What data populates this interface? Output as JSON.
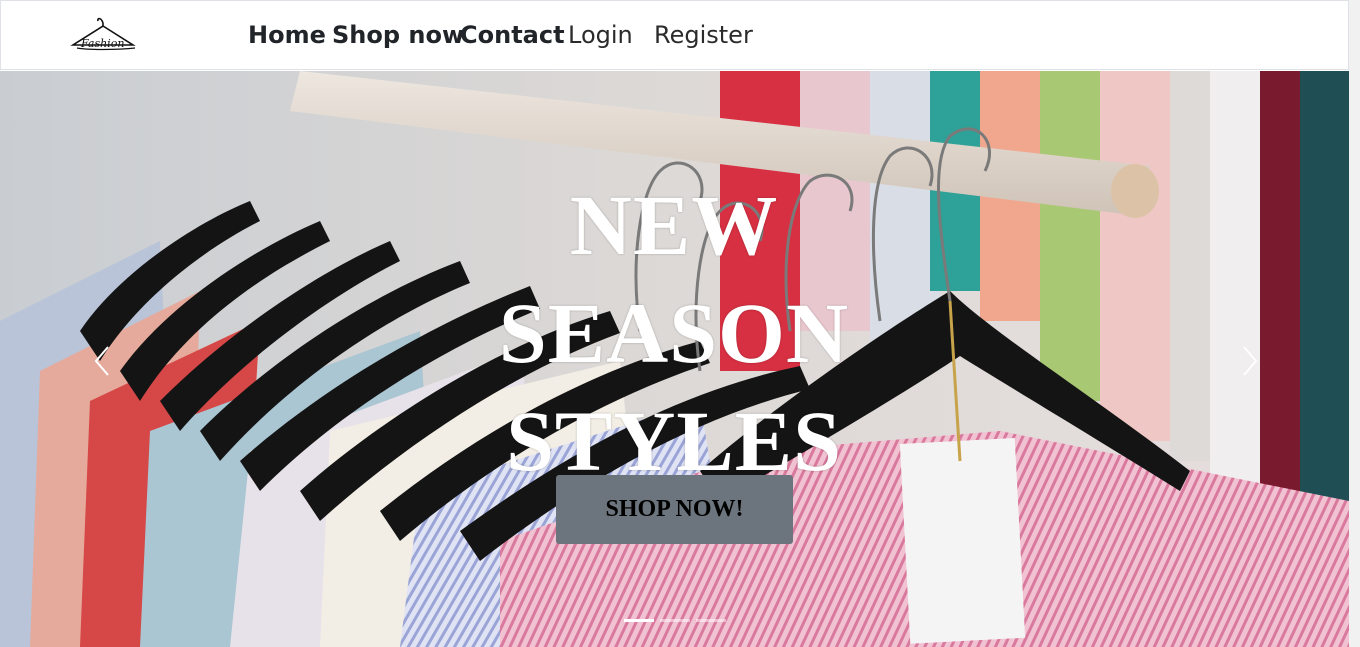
{
  "nav": {
    "logo_text": "Fashion",
    "links": [
      {
        "label": "Home",
        "weight": "bold"
      },
      {
        "label": "Shop now",
        "weight": "bold"
      },
      {
        "label": "Contact",
        "weight": "bold"
      },
      {
        "label": "Login",
        "weight": "normal"
      },
      {
        "label": "Register",
        "weight": "normal"
      }
    ]
  },
  "hero": {
    "headline_lines": [
      "NEW",
      "SEASON",
      "STYLES"
    ],
    "cta_label": "SHOP NOW!",
    "slides_count": 3,
    "active_slide": 1,
    "prev_icon": "chevron-left-icon",
    "next_icon": "chevron-right-icon"
  },
  "colors": {
    "button_bg": "#6c757d",
    "headline": "#ffffff",
    "nav_text": "#212529"
  }
}
